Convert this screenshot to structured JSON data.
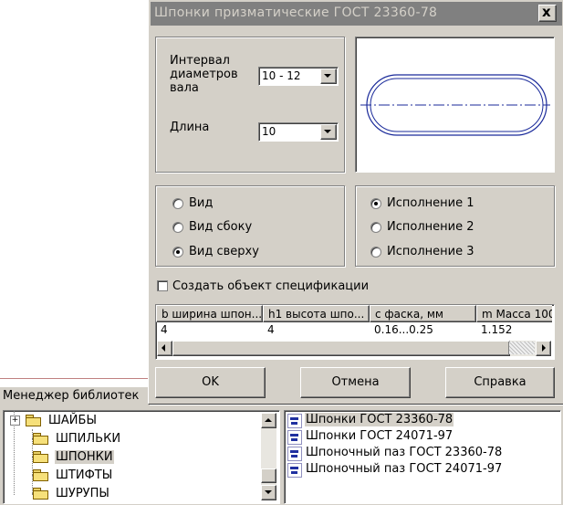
{
  "dialog": {
    "title": "Шпонки призматические  ГОСТ 23360-78",
    "close_label": "x",
    "params": {
      "interval_label": "Интервал\nдиаметров\nвала",
      "interval_value": "10 - 12",
      "length_label": "Длина",
      "length_value": "10"
    },
    "view": {
      "options": [
        "Вид",
        "Вид сбоку",
        "Вид сверху"
      ],
      "selected": "Вид сверху"
    },
    "execution": {
      "options": [
        "Исполнение 1",
        "Исполнение 2",
        "Исполнение 3"
      ],
      "selected": "Исполнение 1"
    },
    "spec_checkbox": {
      "label": "Создать объект спецификации",
      "checked": false
    },
    "table": {
      "columns": [
        "b ширина шпон...",
        "h1 высота шпо...",
        "c фаска, мм",
        "m Масса 100"
      ],
      "rows": [
        [
          "4",
          "4",
          "0.16...0.25",
          "1.152"
        ]
      ]
    },
    "buttons": {
      "ok": "OK",
      "cancel": "Отмена",
      "help": "Справка"
    }
  },
  "library_manager": {
    "title": "Менеджер библиотек",
    "tree": [
      {
        "label": "ШАЙБЫ",
        "expandable": true,
        "selected": false
      },
      {
        "label": "ШПИЛЬКИ",
        "expandable": false,
        "selected": false
      },
      {
        "label": "ШПОНКИ",
        "expandable": false,
        "selected": true
      },
      {
        "label": "ШТИФТЫ",
        "expandable": false,
        "selected": false
      },
      {
        "label": "ШУРУПЫ",
        "expandable": false,
        "selected": false
      }
    ],
    "items": [
      {
        "label": "Шпонки ГОСТ 23360-78",
        "selected": true
      },
      {
        "label": "Шпонки ГОСТ 24071-97",
        "selected": false
      },
      {
        "label": "Шпоночный паз ГОСТ 23360-78",
        "selected": false
      },
      {
        "label": "Шпоночный паз ГОСТ 24071-97",
        "selected": false
      }
    ]
  },
  "colors": {
    "title_inactive": "#808080",
    "face": "#d4d0c8",
    "preview_stroke": "#1a2a9a"
  }
}
